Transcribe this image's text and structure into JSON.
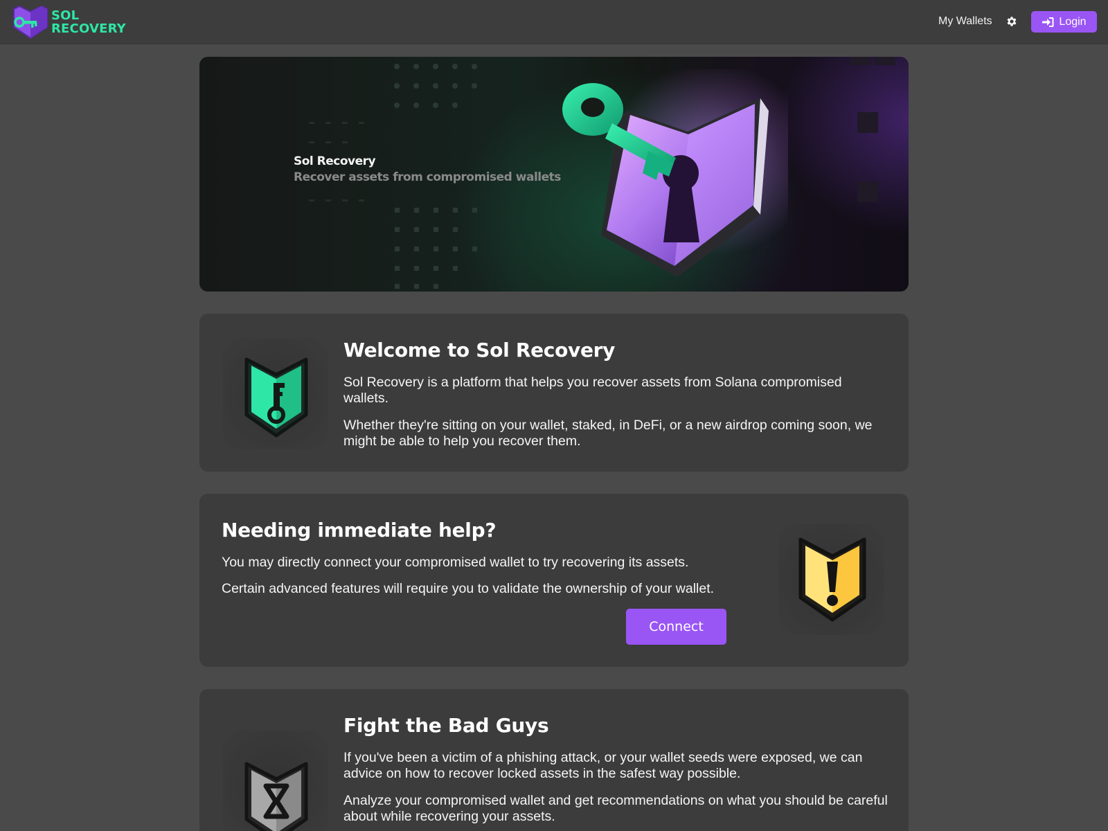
{
  "header": {
    "brand_line1": "SOL",
    "brand_line2": "RECOVERY",
    "nav_my_wallets": "My Wallets",
    "settings_icon": "gear-icon",
    "login_label": "Login",
    "login_icon": "sign-in-icon"
  },
  "banner": {
    "title": "Sol Recovery",
    "subtitle": "Recover assets from compromised wallets"
  },
  "welcome": {
    "title": "Welcome to Sol Recovery",
    "p1": "Sol Recovery is a platform that helps you recover assets from Solana compromised wallets.",
    "p2": "Whether they're sitting on your wallet, staked, in DeFi, or a new airdrop coming soon, we might be able to help you recover them.",
    "icon": "key-shield-icon"
  },
  "help": {
    "title": "Needing immediate help?",
    "p1": "You may directly connect your compromised wallet to try recovering its assets.",
    "p2": "Certain advanced features will require you to validate the ownership of your wallet.",
    "connect_label": "Connect",
    "icon": "warning-shield-icon"
  },
  "fight": {
    "title": "Fight the Bad Guys",
    "p1": "If you've been a victim of a phishing attack, or your wallet seeds were exposed, we can advice on how to recover locked assets in the safest way possible.",
    "p2": "Analyze your compromised wallet and get recommendations on what you should be careful about while recovering your assets.",
    "icon": "hourglass-shield-icon"
  },
  "colors": {
    "accent": "#9a55f5",
    "brand_green": "#2ee6a6",
    "background": "#4a4a4a",
    "card": "#3c3c3c",
    "warning_yellow": "#ffd75e"
  }
}
